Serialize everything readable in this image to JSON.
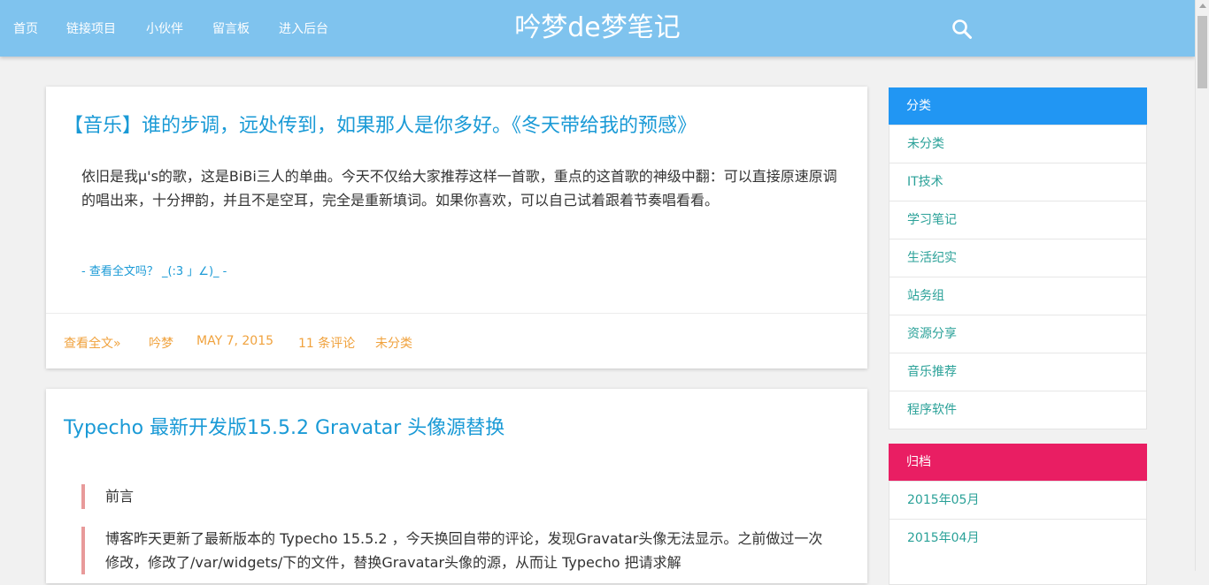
{
  "header": {
    "nav": [
      "首页",
      "链接项目",
      "小伙伴",
      "留言板",
      "进入后台"
    ],
    "site_title": "吟梦de梦笔记",
    "search_icon": "search-icon",
    "bg_color": "#7fc3ee"
  },
  "posts": [
    {
      "title": "【音乐】谁的步调，远处传到，如果那人是你多好。《冬天带给我的预感》",
      "excerpt": "依旧是我μ's的歌，这是BiBi三人的单曲。今天不仅给大家推荐这样一首歌，重点的这首歌的神级中翻：可以直接原速原调的唱出来，十分押韵，并且不是空耳，完全是重新填词。如果你喜欢，可以自己试着跟着节奏唱看看。",
      "read_more_link": "- 查看全文吗？ _(:3 」∠)_ -",
      "meta": {
        "read_full": "查看全文»",
        "author": "吟梦",
        "date": "MAY 7, 2015",
        "comments": "11 条评论",
        "category": "未分类"
      }
    },
    {
      "title": "Typecho 最新开发版15.5.2 Gravatar 头像源替换",
      "quote1": "前言",
      "quote2": "博客昨天更新了最新版本的 Typecho 15.5.2 ，今天换回自带的评论，发现Gravatar头像无法显示。之前做过一次修改，修改了/var/widgets/下的文件，替换Gravatar头像的源，从而让 Typecho 把请求解"
    }
  ],
  "sidebar": {
    "categories": {
      "title": "分类",
      "color": "#2196f3",
      "items": [
        "未分类",
        "IT技术",
        "学习笔记",
        "生活纪实",
        "站务组",
        "资源分享",
        "音乐推荐",
        "程序软件"
      ]
    },
    "archive": {
      "title": "归档",
      "color": "#e91e63",
      "items": [
        "2015年05月",
        "2015年04月"
      ]
    }
  },
  "colors": {
    "link_blue": "#1a9ad6",
    "meta_orange": "#f0a23d",
    "sidebar_link": "#2aa198",
    "quote_border": "#e89a9a"
  }
}
